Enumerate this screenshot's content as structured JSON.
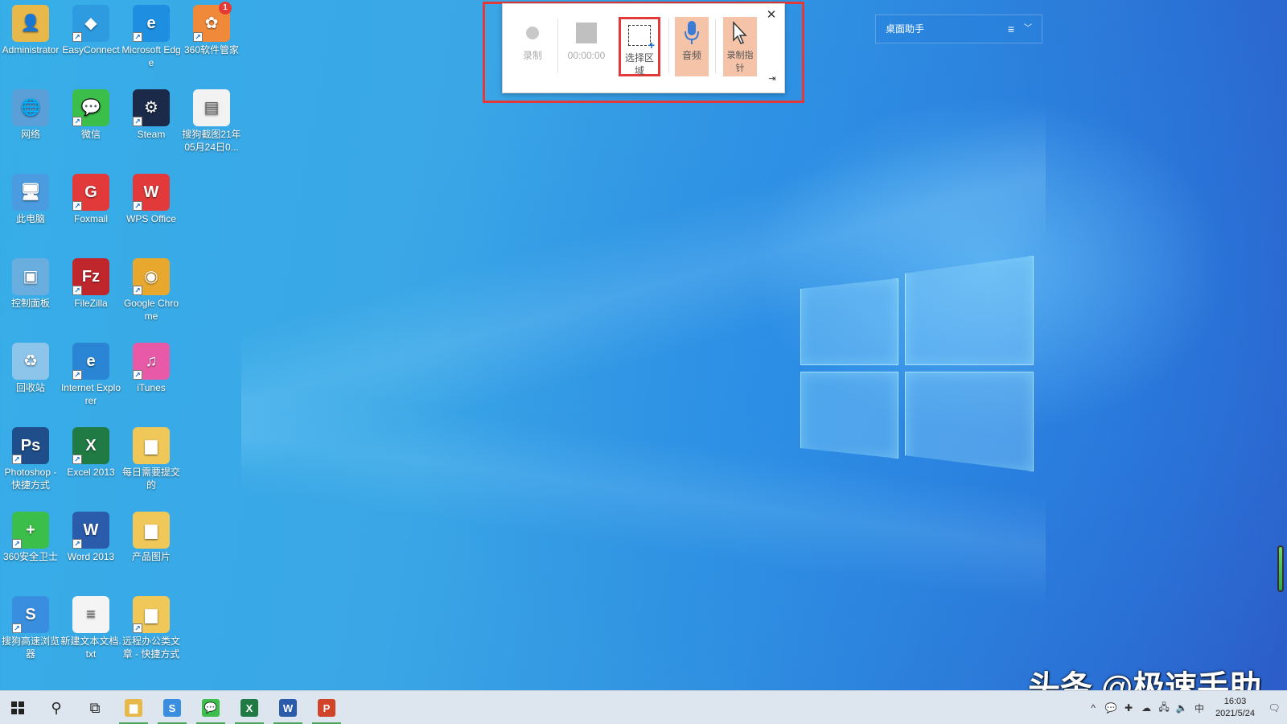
{
  "desktop_icons": [
    {
      "label": "Administrator",
      "icon": "user-folder-icon",
      "color": "#e8b84a",
      "glyph": "👤",
      "shortcut": false,
      "col": 0,
      "row": 0
    },
    {
      "label": "EasyConnect",
      "icon": "easyconnect-icon",
      "color": "#2e9be0",
      "glyph": "◆",
      "shortcut": true,
      "col": 1,
      "row": 0
    },
    {
      "label": "Microsoft Edge",
      "icon": "edge-icon",
      "color": "#1d8ee0",
      "glyph": "e",
      "shortcut": true,
      "col": 2,
      "row": 0
    },
    {
      "label": "360软件管家",
      "icon": "360-manager-icon",
      "color": "#f08a3a",
      "glyph": "✿",
      "shortcut": true,
      "badge": "1",
      "col": 3,
      "row": 0
    },
    {
      "label": "网络",
      "icon": "network-icon",
      "color": "#5a9fd8",
      "glyph": "🌐",
      "shortcut": false,
      "col": 0,
      "row": 1
    },
    {
      "label": "微信",
      "icon": "wechat-icon",
      "color": "#3cbf4a",
      "glyph": "💬",
      "shortcut": true,
      "col": 1,
      "row": 1
    },
    {
      "label": "Steam",
      "icon": "steam-icon",
      "color": "#1b2a49",
      "glyph": "⚙",
      "shortcut": true,
      "col": 2,
      "row": 1
    },
    {
      "label": "搜狗截图21年05月24日0...",
      "icon": "image-file-icon",
      "color": "#f2f2f2",
      "glyph": "▤",
      "shortcut": false,
      "col": 3,
      "row": 1
    },
    {
      "label": "此电脑",
      "icon": "this-pc-icon",
      "color": "#4a9be0",
      "glyph": "🖥",
      "shortcut": false,
      "col": 0,
      "row": 2
    },
    {
      "label": "Foxmail",
      "icon": "foxmail-icon",
      "color": "#e23a3a",
      "glyph": "G",
      "shortcut": true,
      "col": 1,
      "row": 2
    },
    {
      "label": "WPS Office",
      "icon": "wps-icon",
      "color": "#e23a3a",
      "glyph": "W",
      "shortcut": true,
      "col": 2,
      "row": 2
    },
    {
      "label": "控制面板",
      "icon": "control-panel-icon",
      "color": "#6aaee0",
      "glyph": "▣",
      "shortcut": false,
      "col": 0,
      "row": 3
    },
    {
      "label": "FileZilla",
      "icon": "filezilla-icon",
      "color": "#c0272d",
      "glyph": "Fz",
      "shortcut": true,
      "col": 1,
      "row": 3
    },
    {
      "label": "Google Chrome",
      "icon": "chrome-icon",
      "color": "#e8a82e",
      "glyph": "◉",
      "shortcut": true,
      "col": 2,
      "row": 3
    },
    {
      "label": "回收站",
      "icon": "recycle-bin-icon",
      "color": "#8cc4ea",
      "glyph": "♻",
      "shortcut": false,
      "col": 0,
      "row": 4
    },
    {
      "label": "Internet Explorer",
      "icon": "ie-icon",
      "color": "#2a86d4",
      "glyph": "e",
      "shortcut": true,
      "col": 1,
      "row": 4
    },
    {
      "label": "iTunes",
      "icon": "itunes-icon",
      "color": "#e85aa8",
      "glyph": "♫",
      "shortcut": true,
      "col": 2,
      "row": 4
    },
    {
      "label": "Photoshop - 快捷方式",
      "icon": "photoshop-icon",
      "color": "#1f4e8a",
      "glyph": "Ps",
      "shortcut": true,
      "col": 0,
      "row": 5
    },
    {
      "label": "Excel 2013",
      "icon": "excel-icon",
      "color": "#1f7a43",
      "glyph": "X",
      "shortcut": true,
      "col": 1,
      "row": 5
    },
    {
      "label": "每日需要提交的",
      "icon": "folder-icon",
      "color": "#f0c85a",
      "glyph": "▆",
      "shortcut": false,
      "col": 2,
      "row": 5
    },
    {
      "label": "360安全卫士",
      "icon": "360-safe-icon",
      "color": "#3cbf4a",
      "glyph": "+",
      "shortcut": true,
      "col": 0,
      "row": 6
    },
    {
      "label": "Word 2013",
      "icon": "word-icon",
      "color": "#2a5cab",
      "glyph": "W",
      "shortcut": true,
      "col": 1,
      "row": 6
    },
    {
      "label": "产品图片",
      "icon": "image-folder-icon",
      "color": "#f0c85a",
      "glyph": "▆",
      "shortcut": false,
      "col": 2,
      "row": 6
    },
    {
      "label": "搜狗高速浏览器",
      "icon": "sogou-browser-icon",
      "color": "#3a8ee0",
      "glyph": "S",
      "shortcut": true,
      "col": 0,
      "row": 7
    },
    {
      "label": "新建文本文档.txt",
      "icon": "text-file-icon",
      "color": "#f4f4f4",
      "glyph": "≡",
      "shortcut": false,
      "col": 1,
      "row": 7
    },
    {
      "label": "远程办公类文章 - 快捷方式",
      "icon": "folder-icon",
      "color": "#f0c85a",
      "glyph": "▆",
      "shortcut": true,
      "col": 2,
      "row": 7
    }
  ],
  "recorder": {
    "record_label": "录制",
    "timer": "00:00:00",
    "select_area_label": "选择区域",
    "audio_label": "音频",
    "pointer_label": "录制指针",
    "close_glyph": "✕",
    "pin_glyph": "⇥"
  },
  "assistant": {
    "title": "桌面助手",
    "menu_glyph": "≡",
    "chevron_glyph": "﹀"
  },
  "watermark": "头条 @极速手助",
  "taskbar": {
    "apps": [
      {
        "name": "start",
        "active": false
      },
      {
        "name": "search",
        "active": false,
        "glyph": "⚲"
      },
      {
        "name": "task-view",
        "active": false,
        "glyph": "⧉"
      },
      {
        "name": "file-explorer",
        "active": true,
        "glyph": "▆",
        "color": "#e8b84a"
      },
      {
        "name": "sogou-browser",
        "active": true,
        "glyph": "S",
        "color": "#3a8ee0"
      },
      {
        "name": "wechat",
        "active": true,
        "glyph": "💬",
        "color": "#3cbf4a"
      },
      {
        "name": "excel",
        "active": true,
        "glyph": "X",
        "color": "#1f7a43"
      },
      {
        "name": "word",
        "active": true,
        "glyph": "W",
        "color": "#2a5cab"
      },
      {
        "name": "powerpoint",
        "active": true,
        "glyph": "P",
        "color": "#d0442a"
      }
    ],
    "tray_glyphs": [
      "^",
      "💬",
      "✚",
      "☁",
      "🖧",
      "🔈",
      "中"
    ],
    "time": "16:03",
    "date": "2021/5/24",
    "notification_glyph": "🗨"
  }
}
